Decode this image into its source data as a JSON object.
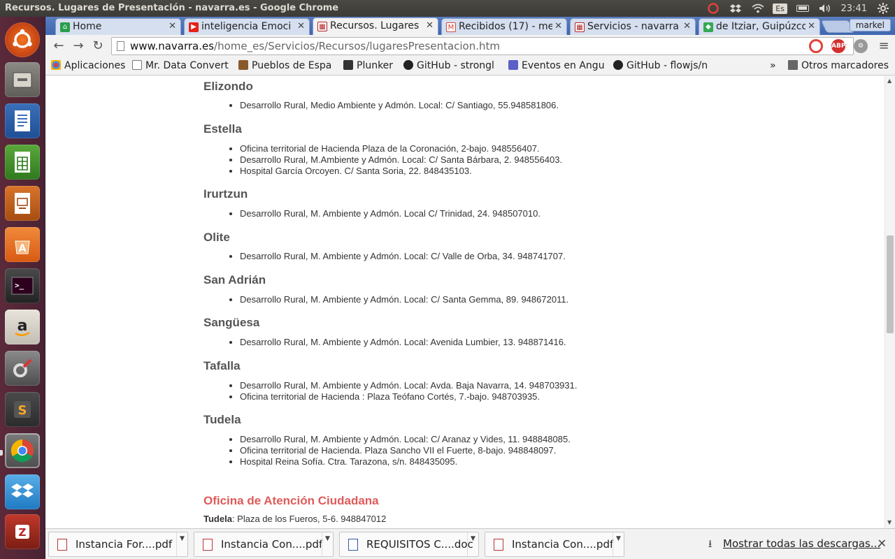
{
  "window": {
    "title": "Recursos. Lugares de Presentación - navarra.es - Google Chrome",
    "clock": "23:41",
    "keyboard_layout": "Es",
    "user": "markel"
  },
  "tabs": [
    {
      "label": "Home",
      "icon": "home-favicon",
      "color": "#2a9d4a"
    },
    {
      "label": "inteligencia Emoci",
      "icon": "youtube-favicon",
      "color": "#e62117"
    },
    {
      "label": "Recursos. Lugares",
      "icon": "navarra-favicon",
      "color": "#b22222",
      "active": true
    },
    {
      "label": "Recibidos (17) - me",
      "icon": "gmail-favicon",
      "color": "#d44638"
    },
    {
      "label": "Servicios - navarra",
      "icon": "navarra-favicon",
      "color": "#b22222"
    },
    {
      "label": "de Itziar, Guipúzco",
      "icon": "maps-favicon",
      "color": "#34a853"
    }
  ],
  "toolbar": {
    "url_host": "www.navarra.es",
    "url_path": "/home_es/Servicios/Recursos/lugaresPresentacion.htm"
  },
  "bookmarks": {
    "apps": "Aplicaciones",
    "items": [
      "Mr. Data Convert",
      "Pueblos de Espa",
      "Plunker",
      "GitHub - strongl",
      "Eventos en Angu",
      "GitHub - flowjs/n"
    ],
    "overflow": "»",
    "other": "Otros marcadores"
  },
  "content": {
    "sections": [
      {
        "city": "Elizondo",
        "items": [
          "Desarrollo Rural, Medio Ambiente y Admón. Local: C/ Santiago, 55.948581806."
        ]
      },
      {
        "city": "Estella",
        "items": [
          "Oficina territorial  de Hacienda  Plaza de la Coronación, 2-bajo. 948556407.",
          "Desarrollo Rural, M.Ambiente y Admón. Local: C/ Santa Bárbara, 2. 948556403.",
          "Hospital García Orcoyen. C/ Santa Soria, 22. 848435103."
        ]
      },
      {
        "city": "Irurtzun",
        "items": [
          "Desarrollo Rural, M. Ambiente y Admón. Local C/ Trinidad, 24. 948507010."
        ]
      },
      {
        "city": "Olite",
        "items": [
          "Desarrollo Rural, M. Ambiente y Admón. Local: C/ Valle de Orba, 34. 948741707."
        ]
      },
      {
        "city": "San Adrián",
        "items": [
          "Desarrollo Rural, M. Ambiente y Admón. Local: C/ Santa Gemma, 89. 948672011."
        ]
      },
      {
        "city": "Sangüesa",
        "items": [
          "Desarrollo Rural, M. Ambiente y Admón. Local: Avenida Lumbier, 13. 948871416."
        ]
      },
      {
        "city": "Tafalla",
        "items": [
          "Desarrollo Rural, M. Ambiente y Admón. Local: Avda. Baja Navarra, 14. 948703931.",
          "Oficina territorial de Hacienda : Plaza Teófano Cortés, 7.-bajo. 948703935."
        ]
      },
      {
        "city": "Tudela",
        "items": [
          "Desarrollo Rural, M. Ambiente y Admón. Local: C/ Aranaz y Vides, 11. 948848085.",
          "Oficina territorial de Hacienda. Plaza Sancho VII el Fuerte, 8-bajo. 948848097.",
          "Hospital Reina Sofía. Ctra. Tarazona, s/n. 848435095."
        ]
      }
    ],
    "oac_title": "Oficina de Atención Ciudadana",
    "oac_city": "Tudela",
    "oac_address": ": Plaza de los Fueros, 5-6. 948847012"
  },
  "downloads": {
    "items": [
      {
        "name": "Instancia For....pdf",
        "type": "pdf"
      },
      {
        "name": "Instancia Con....pdf",
        "type": "pdf"
      },
      {
        "name": "REQUISITOS C....doc",
        "type": "doc"
      },
      {
        "name": "Instancia Con....pdf",
        "type": "pdf"
      }
    ],
    "show_all": "Mostrar todas las descargas..."
  },
  "colors": {
    "section_heading": "#555555",
    "oac_heading": "#e05a5a",
    "launcher_bg": "#5b2a3a"
  }
}
